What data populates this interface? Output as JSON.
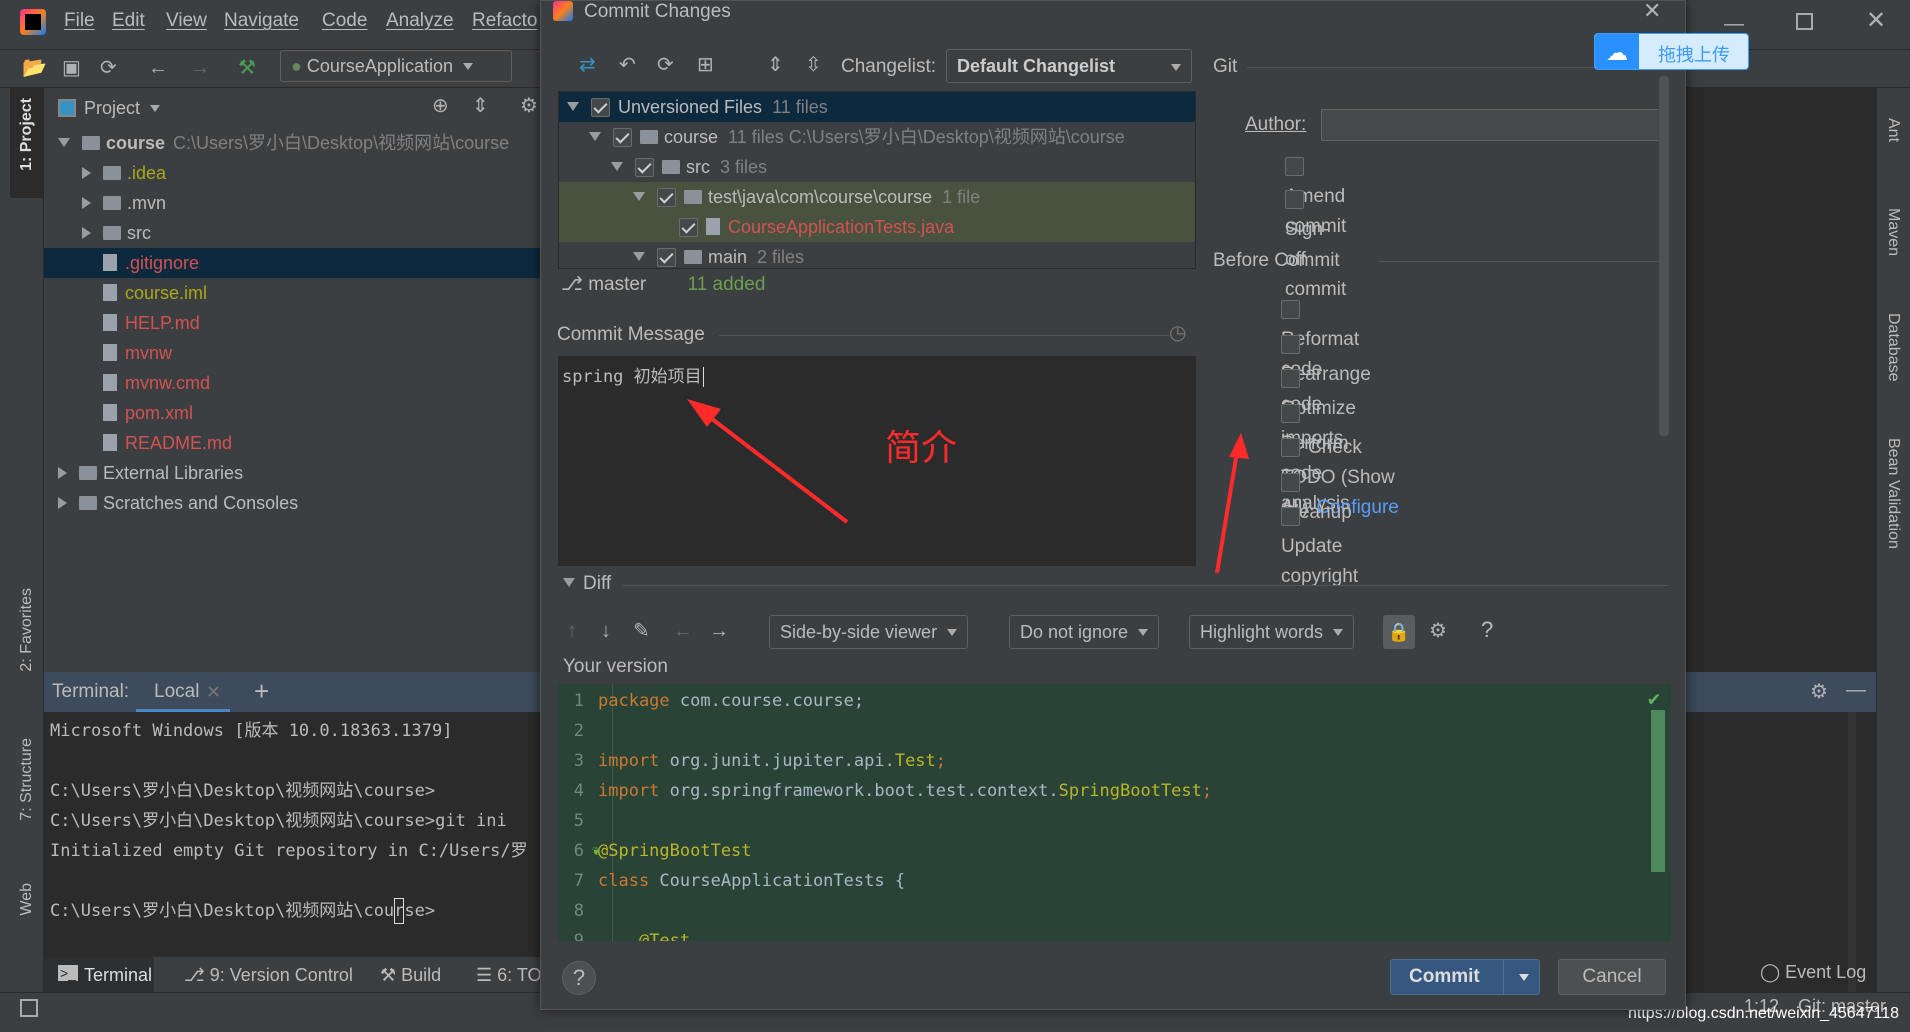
{
  "ide": {
    "menu": [
      "File",
      "Edit",
      "View",
      "Navigate",
      "Code",
      "Analyze",
      "Refacto"
    ],
    "run_config": "CourseApplication",
    "left_tabs": [
      "1: Project",
      "2: Favorites",
      "7: Structure",
      "Web"
    ],
    "right_tabs": [
      "Ant",
      "Maven",
      "Database",
      "Bean Validation"
    ],
    "project": {
      "header": "Project",
      "tree": [
        {
          "label": "course",
          "hint": "C:\\Users\\罗小白\\Desktop\\视频网站\\course",
          "depth": 0,
          "kind": "folder",
          "expanded": true,
          "color": "#bbbbbb",
          "bold": true
        },
        {
          "label": ".idea",
          "depth": 1,
          "kind": "folder",
          "expanded": false,
          "color": "#a8a818"
        },
        {
          "label": ".mvn",
          "depth": 1,
          "kind": "folder",
          "expanded": false,
          "color": "#bbbbbb"
        },
        {
          "label": "src",
          "depth": 1,
          "kind": "folder",
          "expanded": false,
          "color": "#bbbbbb"
        },
        {
          "label": ".gitignore",
          "depth": 1,
          "kind": "file",
          "color": "#d25252",
          "selected": true
        },
        {
          "label": "course.iml",
          "depth": 1,
          "kind": "file",
          "color": "#a8a818"
        },
        {
          "label": "HELP.md",
          "depth": 1,
          "kind": "file",
          "color": "#d25252"
        },
        {
          "label": "mvnw",
          "depth": 1,
          "kind": "file",
          "color": "#d25252"
        },
        {
          "label": "mvnw.cmd",
          "depth": 1,
          "kind": "file",
          "color": "#d25252"
        },
        {
          "label": "pom.xml",
          "depth": 1,
          "kind": "file",
          "color": "#d25252"
        },
        {
          "label": "README.md",
          "depth": 1,
          "kind": "file",
          "color": "#d25252"
        },
        {
          "label": "External Libraries",
          "depth": 0,
          "kind": "lib",
          "expanded": false,
          "color": "#bbbbbb"
        },
        {
          "label": "Scratches and Consoles",
          "depth": 0,
          "kind": "lib",
          "expanded": false,
          "color": "#bbbbbb"
        }
      ]
    },
    "terminal": {
      "label": "Terminal:",
      "tab": "Local",
      "lines": [
        "Microsoft Windows [版本 10.0.18363.1379]",
        "",
        "C:\\Users\\罗小白\\Desktop\\视频网站\\course>",
        "C:\\Users\\罗小白\\Desktop\\视频网站\\course>git ini",
        "Initialized empty Git repository in C:/Users/罗",
        "",
        "C:\\Users\\罗小白\\Desktop\\视频网站\\course>"
      ]
    },
    "bottom_tabs": [
      "Terminal",
      "9: Version Control",
      "Build",
      "6: TO"
    ],
    "event_log": "Event Log",
    "status": {
      "position": "1:12",
      "branch": "Git: master",
      "watermark": "https://blog.csdn.net/weixin_45647118"
    }
  },
  "dialog": {
    "title": "Commit Changes",
    "changelist_label": "Changelist:",
    "changelist_value": "Default Changelist",
    "tree": [
      {
        "label": "Unversioned Files",
        "count": "11 files",
        "depth": 0,
        "checked": true,
        "selected": true,
        "color": "#bbbbbb"
      },
      {
        "label": "course",
        "count": "11 files  C:\\Users\\罗小白\\Desktop\\视频网站\\course",
        "depth": 1,
        "checked": true,
        "color": "#bbbbbb"
      },
      {
        "label": "src",
        "count": "3 files",
        "depth": 2,
        "checked": true,
        "color": "#bbbbbb"
      },
      {
        "label": "test\\java\\com\\course\\course",
        "count": "1 file",
        "depth": 3,
        "checked": true,
        "green": true,
        "color": "#bbbbbb"
      },
      {
        "label": "CourseApplicationTests.java",
        "count": "",
        "depth": 4,
        "checked": true,
        "green": true,
        "file": true,
        "color": "#d25252"
      },
      {
        "label": "main",
        "count": "2 files",
        "depth": 3,
        "checked": true,
        "color": "#bbbbbb"
      }
    ],
    "branch": "master",
    "added": "11 added",
    "commit_message_label": "Commit Message",
    "commit_message": "spring 初始项目",
    "annotation": "简介",
    "git_label": "Git",
    "author_label": "Author:",
    "author_value": "",
    "git_options": [
      {
        "label": "Amend commit",
        "checked": false
      },
      {
        "label": "Sign-off commit",
        "checked": false
      }
    ],
    "before_commit_label": "Before Commit",
    "before_commit": [
      {
        "label": "Reformat code",
        "checked": false
      },
      {
        "label": "Rearrange code",
        "checked": false
      },
      {
        "label": "Optimize imports",
        "checked": false
      },
      {
        "label": "Perform code analysis",
        "checked": false
      },
      {
        "label": "Check TODO (Show All)",
        "checked": false,
        "link": "Configure"
      },
      {
        "label": "Cleanup",
        "checked": false
      },
      {
        "label": "Update copyright",
        "checked": false
      }
    ],
    "diff_label": "Diff",
    "viewer": "Side-by-side viewer",
    "ignore": "Do not ignore",
    "highlight": "Highlight words",
    "help_glyph": "?",
    "your_version": "Your version",
    "code": [
      [
        [
          "kw",
          "package"
        ],
        [
          "p",
          " com.course.course;"
        ]
      ],
      [],
      [
        [
          "kw",
          "import"
        ],
        [
          "p",
          " org.junit.jupiter.api."
        ],
        [
          "an",
          "Test"
        ],
        [
          "kw",
          ";"
        ]
      ],
      [
        [
          "kw",
          "import"
        ],
        [
          "p",
          " org.springframework.boot.test.context."
        ],
        [
          "an",
          "SpringBootTest"
        ],
        [
          "kw",
          ";"
        ]
      ],
      [],
      [
        [
          "an",
          "@SpringBootTest"
        ]
      ],
      [
        [
          "kw",
          "class"
        ],
        [
          "p",
          " CourseApplicationTests {"
        ]
      ],
      [],
      [
        [
          "p",
          "    "
        ],
        [
          "an",
          "@Test"
        ]
      ]
    ],
    "commit_button": "Commit",
    "cancel_button": "Cancel"
  },
  "overlay": {
    "upload_label": "拖拽上传"
  },
  "colors": {
    "keyword": "#cc7832",
    "annotation": "#bbb529",
    "plain": "#a9b7c6",
    "accent": "#365880",
    "link": "#589df6",
    "annotation_red": "#ff2a2a"
  }
}
